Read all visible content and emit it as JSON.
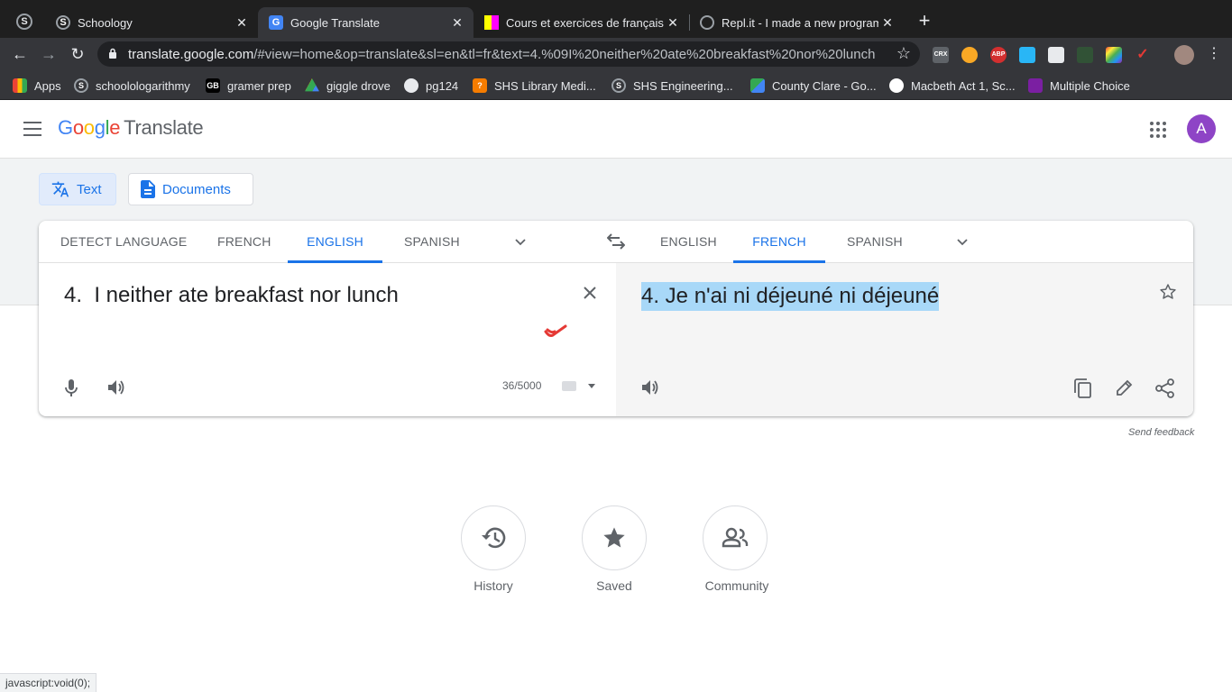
{
  "browser": {
    "tabs": [
      {
        "title": "Schoology",
        "active": false,
        "favicon_color": "#1f1f1f"
      },
      {
        "title": "Google Translate",
        "active": true,
        "favicon_color": "#4285f4"
      },
      {
        "title": "Cours et exercices de français",
        "active": false,
        "favicon_color": "#e8e8e8"
      },
      {
        "title": "Repl.it - I made a new program",
        "active": false,
        "favicon_color": "#5f6368"
      }
    ],
    "url_host": "translate.google.com",
    "url_path": "/#view=home&op=translate&sl=en&tl=fr&text=4.%09I%20neither%20ate%20breakfast%20nor%20lunch",
    "bookmarks": [
      {
        "label": "Apps",
        "icon": "apps-grid-icon"
      },
      {
        "label": "schoolologarithmy",
        "icon": "schoology-icon"
      },
      {
        "label": "gramer prep",
        "icon": "gb-icon"
      },
      {
        "label": "giggle drove",
        "icon": "drive-icon"
      },
      {
        "label": "pg124",
        "icon": "globe-icon"
      },
      {
        "label": "SHS Library Medi...",
        "icon": "library-icon"
      },
      {
        "label": "SHS Engineering...",
        "icon": "schoology-icon"
      },
      {
        "label": "County Clare - Go...",
        "icon": "maps-icon"
      },
      {
        "label": "Macbeth Act 1, Sc...",
        "icon": "macbeth-icon"
      },
      {
        "label": "Multiple Choice",
        "icon": "purple-icon"
      }
    ],
    "extension_crx": "CRX",
    "extension_abp": "ABP",
    "status_url": "javascript:void(0);"
  },
  "header": {
    "logo_letters": [
      "G",
      "o",
      "o",
      "g",
      "l",
      "e"
    ],
    "product": "Translate",
    "avatar_initial": "A"
  },
  "modes": {
    "text": "Text",
    "documents": "Documents"
  },
  "source_langs": [
    "Detect language",
    "French",
    "English",
    "Spanish"
  ],
  "source_selected": "English",
  "target_langs": [
    "English",
    "French",
    "Spanish"
  ],
  "target_selected": "French",
  "source_text": "4.\tI neither ate breakfast nor lunch",
  "char_count": "36/5000",
  "translation": "4. Je n'ai ni déjeuné ni déjeuné",
  "feedback": "Send feedback",
  "quick_links": [
    {
      "label": "History",
      "icon": "history-icon"
    },
    {
      "label": "Saved",
      "icon": "star-icon"
    },
    {
      "label": "Community",
      "icon": "community-icon"
    }
  ],
  "colors": {
    "accent": "#1a73e8",
    "highlight": "#a8d8f8",
    "avatar": "#8e44c6"
  }
}
